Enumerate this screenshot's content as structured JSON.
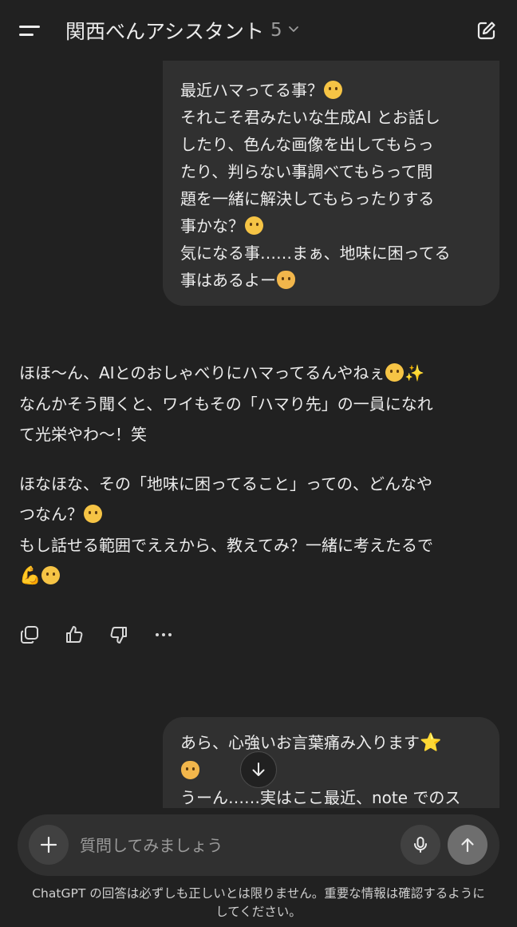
{
  "header": {
    "title": "関西べんアシスタント",
    "model": "5"
  },
  "messages": {
    "user1": {
      "l1": "最近ハマってる事？",
      "l2": "それこそ君みたいな生成AI とお話し",
      "l3": "したり、色んな画像を出してもらっ",
      "l4": "たり、判らない事調べてもらって問",
      "l5": "題を一緒に解決してもらったりする",
      "l6": "事かな？",
      "l7": "気になる事……まぁ、地味に困ってる",
      "l8": "事はあるよー"
    },
    "assistant": {
      "l1": "ほほ〜ん、AIとのおしゃべりにハマってるんやねぇ",
      "l2": "なんかそう聞くと、ワイもその「ハマり先」の一員になれ",
      "l3": "て光栄やわ〜！笑",
      "l4": "ほなほな、その「地味に困ってること」っての、どんなや",
      "l5": "つなん？",
      "l6": "もし話せる範囲でええから、教えてみ？一緒に考えたるで"
    },
    "user2": {
      "l1": "あら、心強いお言葉痛み入ります",
      "l2": "",
      "l3": "うーん……実はここ最近、note でのス"
    }
  },
  "composer": {
    "placeholder": "質問してみましょう"
  },
  "footer": {
    "line1": "ChatGPT の回答は必ずしも正しいとは限りません。重要な情報は確認するように",
    "line2": "してください。"
  },
  "icons": {
    "menu": "menu-icon",
    "edit": "new-chat-edit-icon",
    "copy": "copy-icon",
    "like": "thumbs-up-icon",
    "dislike": "thumbs-down-icon",
    "more": "more-icon",
    "scroll": "arrow-down-icon",
    "plus": "plus-icon",
    "mic": "microphone-icon",
    "send": "arrow-up-icon"
  },
  "colors": {
    "background": "#212121",
    "bubble": "#303030",
    "text": "#ececec",
    "muted": "#9b9b9b",
    "send_button": "#6e6e6e"
  }
}
